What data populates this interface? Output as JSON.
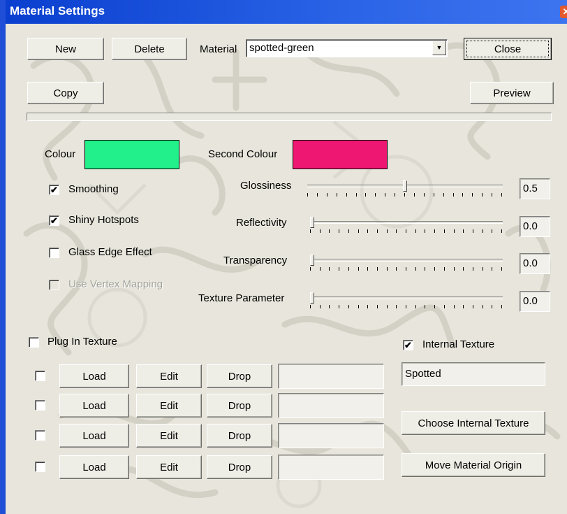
{
  "window": {
    "title": "Material Settings"
  },
  "toolbar": {
    "new_label": "New",
    "delete_label": "Delete",
    "material_label": "Material",
    "material_value": "spotted-green",
    "close_label": "Close",
    "copy_label": "Copy",
    "preview_label": "Preview"
  },
  "colours": {
    "colour_label": "Colour",
    "colour_value": "#22f08a",
    "second_label": "Second Colour",
    "second_value": "#ee1872"
  },
  "options": {
    "smoothing": {
      "label": "Smoothing",
      "checked": true
    },
    "shiny_hotspots": {
      "label": "Shiny Hotspots",
      "checked": true
    },
    "glass_edge": {
      "label": "Glass Edge Effect",
      "checked": false
    },
    "vertex_mapping": {
      "label": "Use Vertex Mapping",
      "checked": false,
      "disabled": true
    }
  },
  "sliders": {
    "glossiness": {
      "label": "Glossiness",
      "value": "0.5",
      "fraction": 0.5
    },
    "reflectivity": {
      "label": "Reflectivity",
      "value": "0.0",
      "fraction": 0.0
    },
    "transparency": {
      "label": "Transparency",
      "value": "0.0",
      "fraction": 0.0
    },
    "texture_parameter": {
      "label": "Texture Parameter",
      "value": "0.0",
      "fraction": 0.0
    }
  },
  "plugin_texture": {
    "label": "Plug In Texture",
    "checked": false,
    "load_label": "Load",
    "edit_label": "Edit",
    "drop_label": "Drop"
  },
  "internal_texture": {
    "label": "Internal Texture",
    "checked": true,
    "value": "Spotted",
    "choose_label": "Choose Internal Texture",
    "move_origin_label": "Move Material Origin"
  },
  "colors": {
    "title_bar": "#0a3fcf",
    "dialog_bg": "#e8e6dc"
  }
}
